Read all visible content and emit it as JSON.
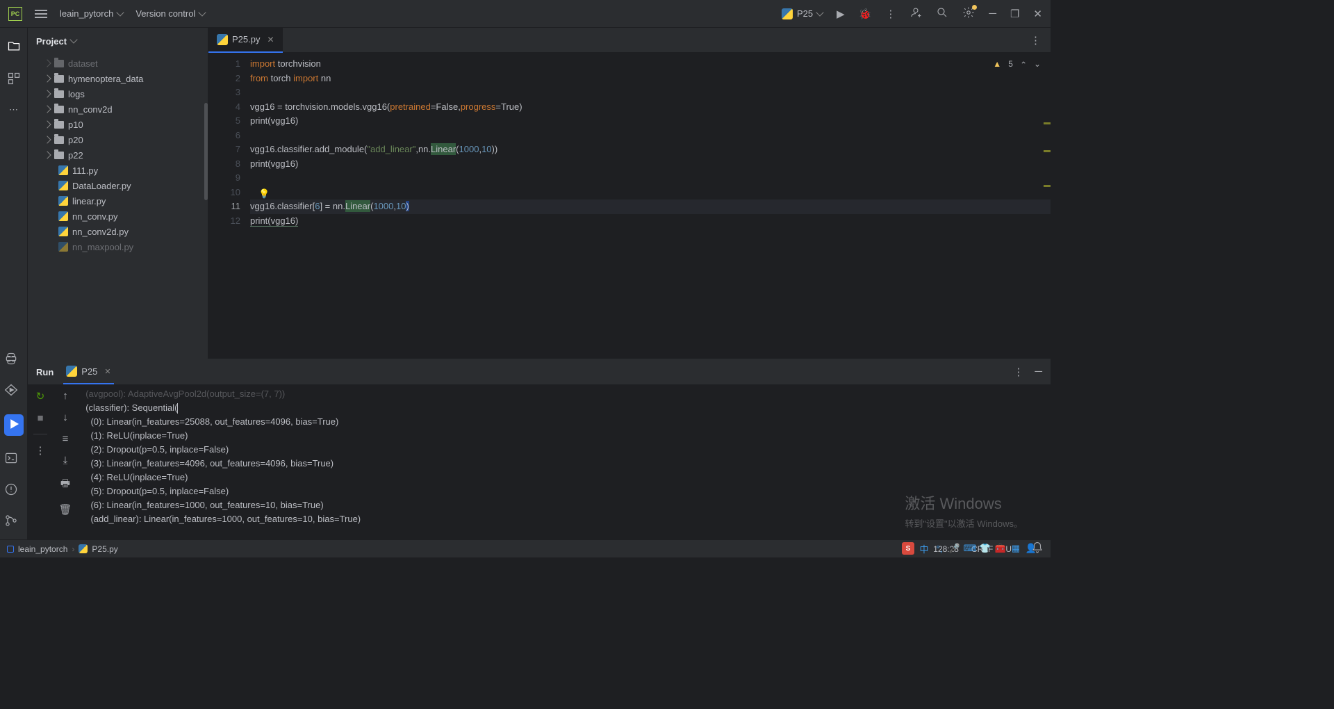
{
  "titlebar": {
    "project_name": "leain_pytorch",
    "vcs_label": "Version control",
    "run_config": "P25"
  },
  "project": {
    "header": "Project",
    "tree": [
      {
        "type": "folder",
        "name": "dataset",
        "indent": 24,
        "dim": true
      },
      {
        "type": "folder",
        "name": "hymenoptera_data",
        "indent": 24
      },
      {
        "type": "folder",
        "name": "logs",
        "indent": 24
      },
      {
        "type": "folder",
        "name": "nn_conv2d",
        "indent": 24
      },
      {
        "type": "folder",
        "name": "p10",
        "indent": 24
      },
      {
        "type": "folder",
        "name": "p20",
        "indent": 24
      },
      {
        "type": "folder",
        "name": "p22",
        "indent": 24
      },
      {
        "type": "py",
        "name": "111.py",
        "indent": 44
      },
      {
        "type": "py",
        "name": "DataLoader.py",
        "indent": 44
      },
      {
        "type": "py",
        "name": "linear.py",
        "indent": 44
      },
      {
        "type": "py",
        "name": "nn_conv.py",
        "indent": 44
      },
      {
        "type": "py",
        "name": "nn_conv2d.py",
        "indent": 44
      },
      {
        "type": "py",
        "name": "nn_maxpool.py",
        "indent": 44,
        "dim": true
      }
    ]
  },
  "editor": {
    "tab_name": "P25.py",
    "inspection_count": "5",
    "lines": [
      {
        "n": 1,
        "seg": [
          {
            "t": "import",
            "c": "kw"
          },
          {
            "t": " torchvision"
          }
        ]
      },
      {
        "n": 2,
        "seg": [
          {
            "t": "from",
            "c": "kw"
          },
          {
            "t": " torch "
          },
          {
            "t": "import",
            "c": "kw"
          },
          {
            "t": " nn"
          }
        ]
      },
      {
        "n": 3,
        "seg": []
      },
      {
        "n": 4,
        "seg": [
          {
            "t": "vgg16 = torchvision.models.vgg16("
          },
          {
            "t": "pretrained",
            "c": "param"
          },
          {
            "t": "=False,"
          },
          {
            "t": "progress",
            "c": "param"
          },
          {
            "t": "=True)"
          }
        ]
      },
      {
        "n": 5,
        "seg": [
          {
            "t": "print(vgg16)"
          }
        ]
      },
      {
        "n": 6,
        "seg": []
      },
      {
        "n": 7,
        "seg": [
          {
            "t": "vgg16.classifier.add_module("
          },
          {
            "t": "\"add_linear\"",
            "c": "str"
          },
          {
            "t": ",nn."
          },
          {
            "t": "Linear",
            "c": "hlbg"
          },
          {
            "t": "("
          },
          {
            "t": "1000",
            "c": "num"
          },
          {
            "t": ","
          },
          {
            "t": "10",
            "c": "num"
          },
          {
            "t": "))"
          }
        ]
      },
      {
        "n": 8,
        "seg": [
          {
            "t": "print(vgg16)"
          }
        ]
      },
      {
        "n": 9,
        "seg": []
      },
      {
        "n": 10,
        "seg": []
      },
      {
        "n": 11,
        "seg": [
          {
            "t": "vgg16.classifier["
          },
          {
            "t": "6",
            "c": "num"
          },
          {
            "t": "] = nn."
          },
          {
            "t": "Linear",
            "c": "hlbg"
          },
          {
            "t": "("
          },
          {
            "t": "1000",
            "c": "num"
          },
          {
            "t": ","
          },
          {
            "t": "10",
            "c": "num"
          },
          {
            "t": ")",
            "c": "sel"
          }
        ]
      },
      {
        "n": 12,
        "seg": [
          {
            "t": "print(vgg16)",
            "u": true
          }
        ]
      }
    ],
    "current_line": 11
  },
  "run": {
    "header": "Run",
    "tab": "P25",
    "output": [
      "  (avgpool): AdaptiveAvgPool2d(output_size=(7, 7))",
      "  (classifier): Sequential(",
      "    (0): Linear(in_features=25088, out_features=4096, bias=True)",
      "    (1): ReLU(inplace=True)",
      "    (2): Dropout(p=0.5, inplace=False)",
      "    (3): Linear(in_features=4096, out_features=4096, bias=True)",
      "    (4): ReLU(inplace=True)",
      "    (5): Dropout(p=0.5, inplace=False)",
      "    (6): Linear(in_features=1000, out_features=10, bias=True)",
      "    (add_linear): Linear(in_features=1000, out_features=10, bias=True)"
    ]
  },
  "statusbar": {
    "crumb_project": "leain_pytorch",
    "crumb_file": "P25.py",
    "pos": "128:28",
    "eol": "CRLF",
    "enc": "U"
  },
  "watermark": {
    "line1": "激活 Windows",
    "line2": "转到\"设置\"以激活 Windows。"
  },
  "ime": {
    "label": "中"
  }
}
